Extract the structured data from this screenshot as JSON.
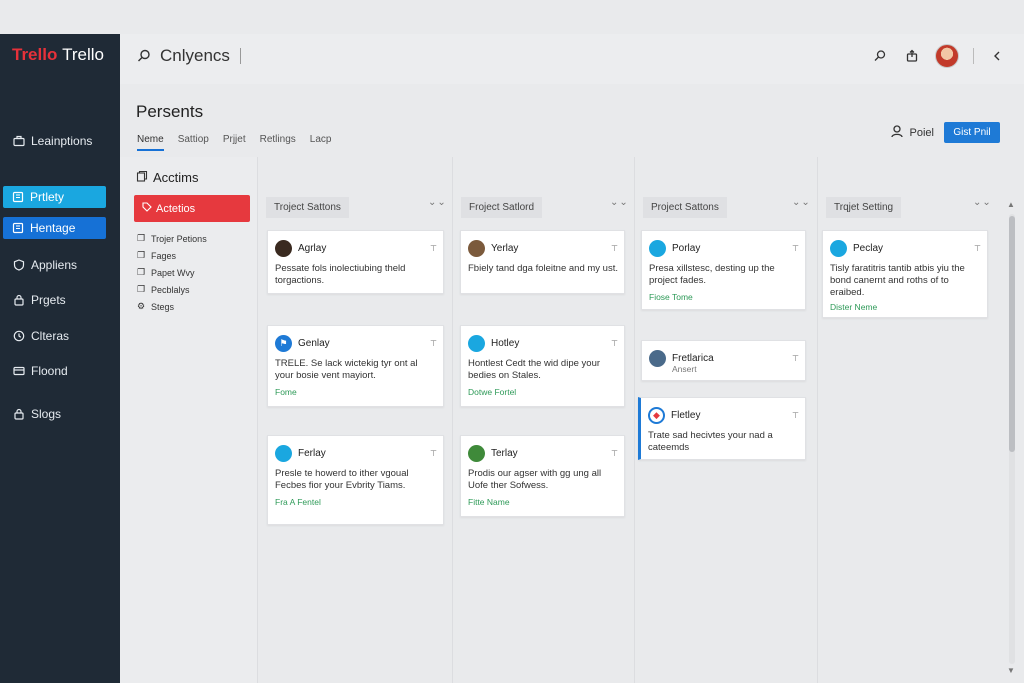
{
  "app": {
    "brand_red": "Trello",
    "brand_white": "Trello"
  },
  "topbar": {
    "search_text": "Cnlyencs"
  },
  "sidebar": {
    "items": [
      {
        "label": "Leainptions",
        "icon": "briefcase-icon"
      },
      {
        "label": "Prtlety",
        "icon": "board-icon",
        "style": "cyan"
      },
      {
        "label": "Hentage",
        "icon": "board-icon",
        "style": "blue"
      },
      {
        "label": "Appliens",
        "icon": "shield-icon"
      },
      {
        "label": "Prgets",
        "icon": "lock-icon"
      },
      {
        "label": "Clteras",
        "icon": "clock-icon"
      },
      {
        "label": "Floond",
        "icon": "card-icon"
      },
      {
        "label": "Slogs",
        "icon": "lock-icon"
      }
    ]
  },
  "page": {
    "title": "Persents",
    "tabs": [
      "Neme",
      "Sattiop",
      "Prjjet",
      "Retlings",
      "Lacp"
    ],
    "user_label": "Poiel",
    "primary_button": "Gist Pnil"
  },
  "panel": {
    "title": "Acctims",
    "red_button": "Actetios",
    "items": [
      {
        "label": "Trojer Petions",
        "icon": "copy-icon"
      },
      {
        "label": "Fages",
        "icon": "copy-icon"
      },
      {
        "label": "Papet Wvy",
        "icon": "copy-icon"
      },
      {
        "label": "Pecblalys",
        "icon": "copy-icon"
      },
      {
        "label": "Stegs",
        "icon": "gear-icon"
      }
    ]
  },
  "columns": [
    {
      "header": "Troject Sattons",
      "cards": [
        {
          "name": "Agrlay",
          "text": "Pessate fols inolectiubing theld torgactions.",
          "link": ""
        },
        {
          "name": "Genlay",
          "text": "TRELE. Se lack wictekig tyr ont al your bosie vent mayiort.",
          "link": "Fome"
        },
        {
          "name": "Ferlay",
          "text": "Presle te howerd to ither vgoual Fecbes fior your Evbrity Tiams.",
          "link": "Fra A Fentel"
        }
      ]
    },
    {
      "header": "Froject Satlord",
      "cards": [
        {
          "name": "Yerlay",
          "text": "Fbiely tand dga foleitne and my ust.",
          "link": ""
        },
        {
          "name": "Hotley",
          "text": "Hontlest Cedt the wid dipe your bedies on Stales.",
          "link": "Dotwe Fortel"
        },
        {
          "name": "Terlay",
          "text": "Prodis our agser with gg ung all Uofe ther Sofwess.",
          "link": "Fitte Name"
        }
      ]
    },
    {
      "header": "Project Sattons",
      "cards": [
        {
          "name": "Porlay",
          "text": "Presa xillstesc, desting up the project fades.",
          "link": "Fiose Tome"
        },
        {
          "name": "Fretlarica",
          "text": "",
          "sub": "Ansert",
          "link": ""
        },
        {
          "name": "Fletley",
          "text": "Trate sad hecivtes your nad a cateemds",
          "link": ""
        }
      ]
    },
    {
      "header": "Trqjet Setting",
      "cards": [
        {
          "name": "Peclay",
          "text": "Tisly faratitris tantib atbis yiu the bond canernt and roths of to eraibed.",
          "link": "Dister Neme"
        }
      ]
    }
  ],
  "colors": {
    "sidebar_bg": "#1f2a36",
    "brand_red": "#e6313a",
    "accent_blue": "#1e7ad6",
    "accent_cyan": "#1aa7e0",
    "danger_red": "#e6393e",
    "link_green": "#2e9a58"
  }
}
